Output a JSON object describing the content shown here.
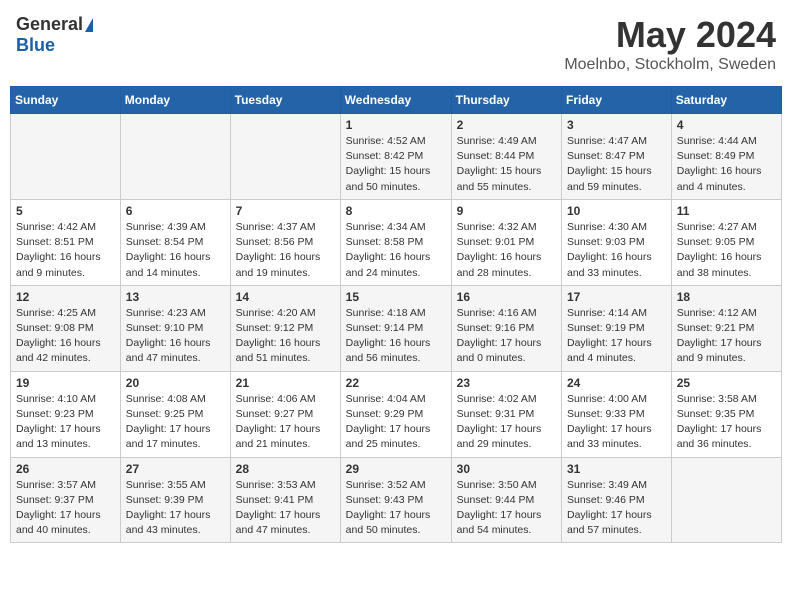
{
  "header": {
    "logo_general": "General",
    "logo_blue": "Blue",
    "title_month": "May 2024",
    "title_location": "Moelnbo, Stockholm, Sweden"
  },
  "weekdays": [
    "Sunday",
    "Monday",
    "Tuesday",
    "Wednesday",
    "Thursday",
    "Friday",
    "Saturday"
  ],
  "weeks": [
    [
      {
        "day": "",
        "info": ""
      },
      {
        "day": "",
        "info": ""
      },
      {
        "day": "",
        "info": ""
      },
      {
        "day": "1",
        "info": "Sunrise: 4:52 AM\nSunset: 8:42 PM\nDaylight: 15 hours\nand 50 minutes."
      },
      {
        "day": "2",
        "info": "Sunrise: 4:49 AM\nSunset: 8:44 PM\nDaylight: 15 hours\nand 55 minutes."
      },
      {
        "day": "3",
        "info": "Sunrise: 4:47 AM\nSunset: 8:47 PM\nDaylight: 15 hours\nand 59 minutes."
      },
      {
        "day": "4",
        "info": "Sunrise: 4:44 AM\nSunset: 8:49 PM\nDaylight: 16 hours\nand 4 minutes."
      }
    ],
    [
      {
        "day": "5",
        "info": "Sunrise: 4:42 AM\nSunset: 8:51 PM\nDaylight: 16 hours\nand 9 minutes."
      },
      {
        "day": "6",
        "info": "Sunrise: 4:39 AM\nSunset: 8:54 PM\nDaylight: 16 hours\nand 14 minutes."
      },
      {
        "day": "7",
        "info": "Sunrise: 4:37 AM\nSunset: 8:56 PM\nDaylight: 16 hours\nand 19 minutes."
      },
      {
        "day": "8",
        "info": "Sunrise: 4:34 AM\nSunset: 8:58 PM\nDaylight: 16 hours\nand 24 minutes."
      },
      {
        "day": "9",
        "info": "Sunrise: 4:32 AM\nSunset: 9:01 PM\nDaylight: 16 hours\nand 28 minutes."
      },
      {
        "day": "10",
        "info": "Sunrise: 4:30 AM\nSunset: 9:03 PM\nDaylight: 16 hours\nand 33 minutes."
      },
      {
        "day": "11",
        "info": "Sunrise: 4:27 AM\nSunset: 9:05 PM\nDaylight: 16 hours\nand 38 minutes."
      }
    ],
    [
      {
        "day": "12",
        "info": "Sunrise: 4:25 AM\nSunset: 9:08 PM\nDaylight: 16 hours\nand 42 minutes."
      },
      {
        "day": "13",
        "info": "Sunrise: 4:23 AM\nSunset: 9:10 PM\nDaylight: 16 hours\nand 47 minutes."
      },
      {
        "day": "14",
        "info": "Sunrise: 4:20 AM\nSunset: 9:12 PM\nDaylight: 16 hours\nand 51 minutes."
      },
      {
        "day": "15",
        "info": "Sunrise: 4:18 AM\nSunset: 9:14 PM\nDaylight: 16 hours\nand 56 minutes."
      },
      {
        "day": "16",
        "info": "Sunrise: 4:16 AM\nSunset: 9:16 PM\nDaylight: 17 hours\nand 0 minutes."
      },
      {
        "day": "17",
        "info": "Sunrise: 4:14 AM\nSunset: 9:19 PM\nDaylight: 17 hours\nand 4 minutes."
      },
      {
        "day": "18",
        "info": "Sunrise: 4:12 AM\nSunset: 9:21 PM\nDaylight: 17 hours\nand 9 minutes."
      }
    ],
    [
      {
        "day": "19",
        "info": "Sunrise: 4:10 AM\nSunset: 9:23 PM\nDaylight: 17 hours\nand 13 minutes."
      },
      {
        "day": "20",
        "info": "Sunrise: 4:08 AM\nSunset: 9:25 PM\nDaylight: 17 hours\nand 17 minutes."
      },
      {
        "day": "21",
        "info": "Sunrise: 4:06 AM\nSunset: 9:27 PM\nDaylight: 17 hours\nand 21 minutes."
      },
      {
        "day": "22",
        "info": "Sunrise: 4:04 AM\nSunset: 9:29 PM\nDaylight: 17 hours\nand 25 minutes."
      },
      {
        "day": "23",
        "info": "Sunrise: 4:02 AM\nSunset: 9:31 PM\nDaylight: 17 hours\nand 29 minutes."
      },
      {
        "day": "24",
        "info": "Sunrise: 4:00 AM\nSunset: 9:33 PM\nDaylight: 17 hours\nand 33 minutes."
      },
      {
        "day": "25",
        "info": "Sunrise: 3:58 AM\nSunset: 9:35 PM\nDaylight: 17 hours\nand 36 minutes."
      }
    ],
    [
      {
        "day": "26",
        "info": "Sunrise: 3:57 AM\nSunset: 9:37 PM\nDaylight: 17 hours\nand 40 minutes."
      },
      {
        "day": "27",
        "info": "Sunrise: 3:55 AM\nSunset: 9:39 PM\nDaylight: 17 hours\nand 43 minutes."
      },
      {
        "day": "28",
        "info": "Sunrise: 3:53 AM\nSunset: 9:41 PM\nDaylight: 17 hours\nand 47 minutes."
      },
      {
        "day": "29",
        "info": "Sunrise: 3:52 AM\nSunset: 9:43 PM\nDaylight: 17 hours\nand 50 minutes."
      },
      {
        "day": "30",
        "info": "Sunrise: 3:50 AM\nSunset: 9:44 PM\nDaylight: 17 hours\nand 54 minutes."
      },
      {
        "day": "31",
        "info": "Sunrise: 3:49 AM\nSunset: 9:46 PM\nDaylight: 17 hours\nand 57 minutes."
      },
      {
        "day": "",
        "info": ""
      }
    ]
  ]
}
